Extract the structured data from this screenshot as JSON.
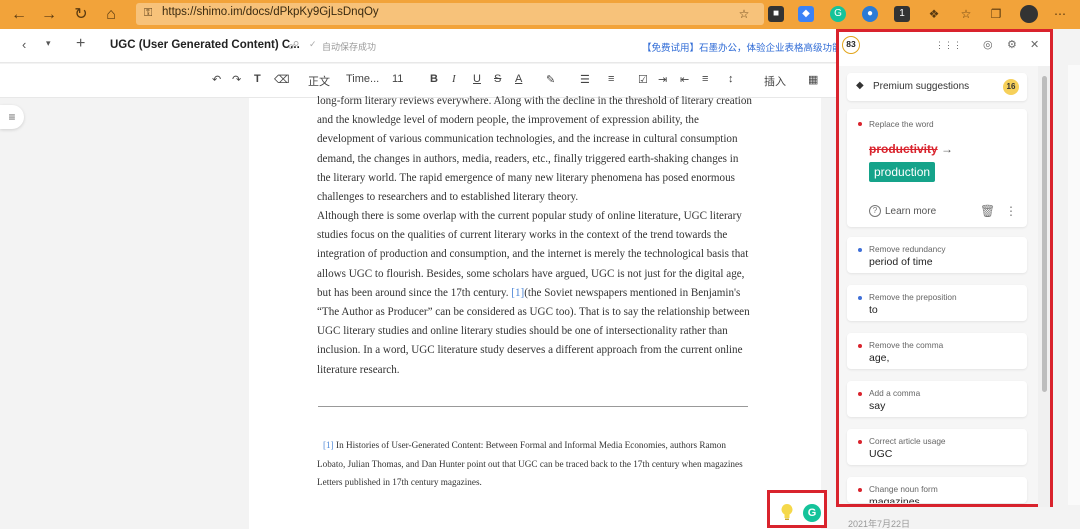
{
  "browser": {
    "url": "https://shimo.im/docs/dPkpKy9GjLsDnqOy",
    "ext_badge_count": "1"
  },
  "doc": {
    "title": "UGC (User Generated Content) C...",
    "save_status": "自动保存成功",
    "promo": "【免费试用】石墨办公，体验企业表格高级功能",
    "toolbar": {
      "style": "正文",
      "font": "Time...",
      "size": "11",
      "insert": "插入"
    },
    "paragraphs": [
      "long-form literary reviews everywhere. Along with the decline in the threshold of literary creation and the knowledge level of modern people, the improvement of expression ability, the development of various communication technologies, and the increase in cultural consumption demand, the changes in authors, media, readers, etc., finally triggered earth-shaking changes in the literary world. The rapid emergence of many new literary phenomena has posed enormous challenges to researchers and to established literary theory.",
      "Although there is some overlap with the current popular study of online literature, UGC literary studies focus on the qualities of current literary works in the context of the trend towards the integration of production and consumption, and the internet is merely the technological basis that allows UGC to flourish. Besides, some scholars have argued, UGC is not just for the digital age, but has been around since the 17th century.",
      "(the Soviet newspapers mentioned in Benjamin's “The Author as Producer” can be considered as UGC too). That is to say the relationship between UGC literary studies and online literary studies should be one of intersectionality rather than inclusion. In a word, UGC literature study deserves a different approach from the current online literature research."
    ],
    "ref_marker": "[1]",
    "footnote": "In Histories of User-Generated Content: Between Formal and Informal Media Economies, authors Ramon Lobato, Julian Thomas, and Dan Hunter point out that UGC can be traced back to the 17th century when magazines Letters published in 17th century magazines.",
    "date": "2021年7月22日"
  },
  "grammarly": {
    "score": "83",
    "premium_label": "Premium suggestions",
    "premium_count": "16",
    "main": {
      "category": "Replace the word",
      "original": "productivity",
      "replacement": "production",
      "learn_more": "Learn more"
    },
    "suggestions": [
      {
        "category": "Remove redundancy",
        "word": "period of time",
        "dot": "#3f6fd8"
      },
      {
        "category": "Remove the preposition",
        "word": "to",
        "dot": "#3f6fd8"
      },
      {
        "category": "Remove the comma",
        "word": "age,",
        "dot": "#d9232d"
      },
      {
        "category": "Add a comma",
        "word": "say",
        "dot": "#d9232d"
      },
      {
        "category": "Correct article usage",
        "word": "UGC",
        "dot": "#d9232d"
      },
      {
        "category": "Change noun form",
        "word": "magazines",
        "dot": "#d9232d"
      }
    ],
    "colors": {
      "accent": "#15c39a",
      "error": "#d9232d",
      "highlight": "#d9232d"
    }
  }
}
